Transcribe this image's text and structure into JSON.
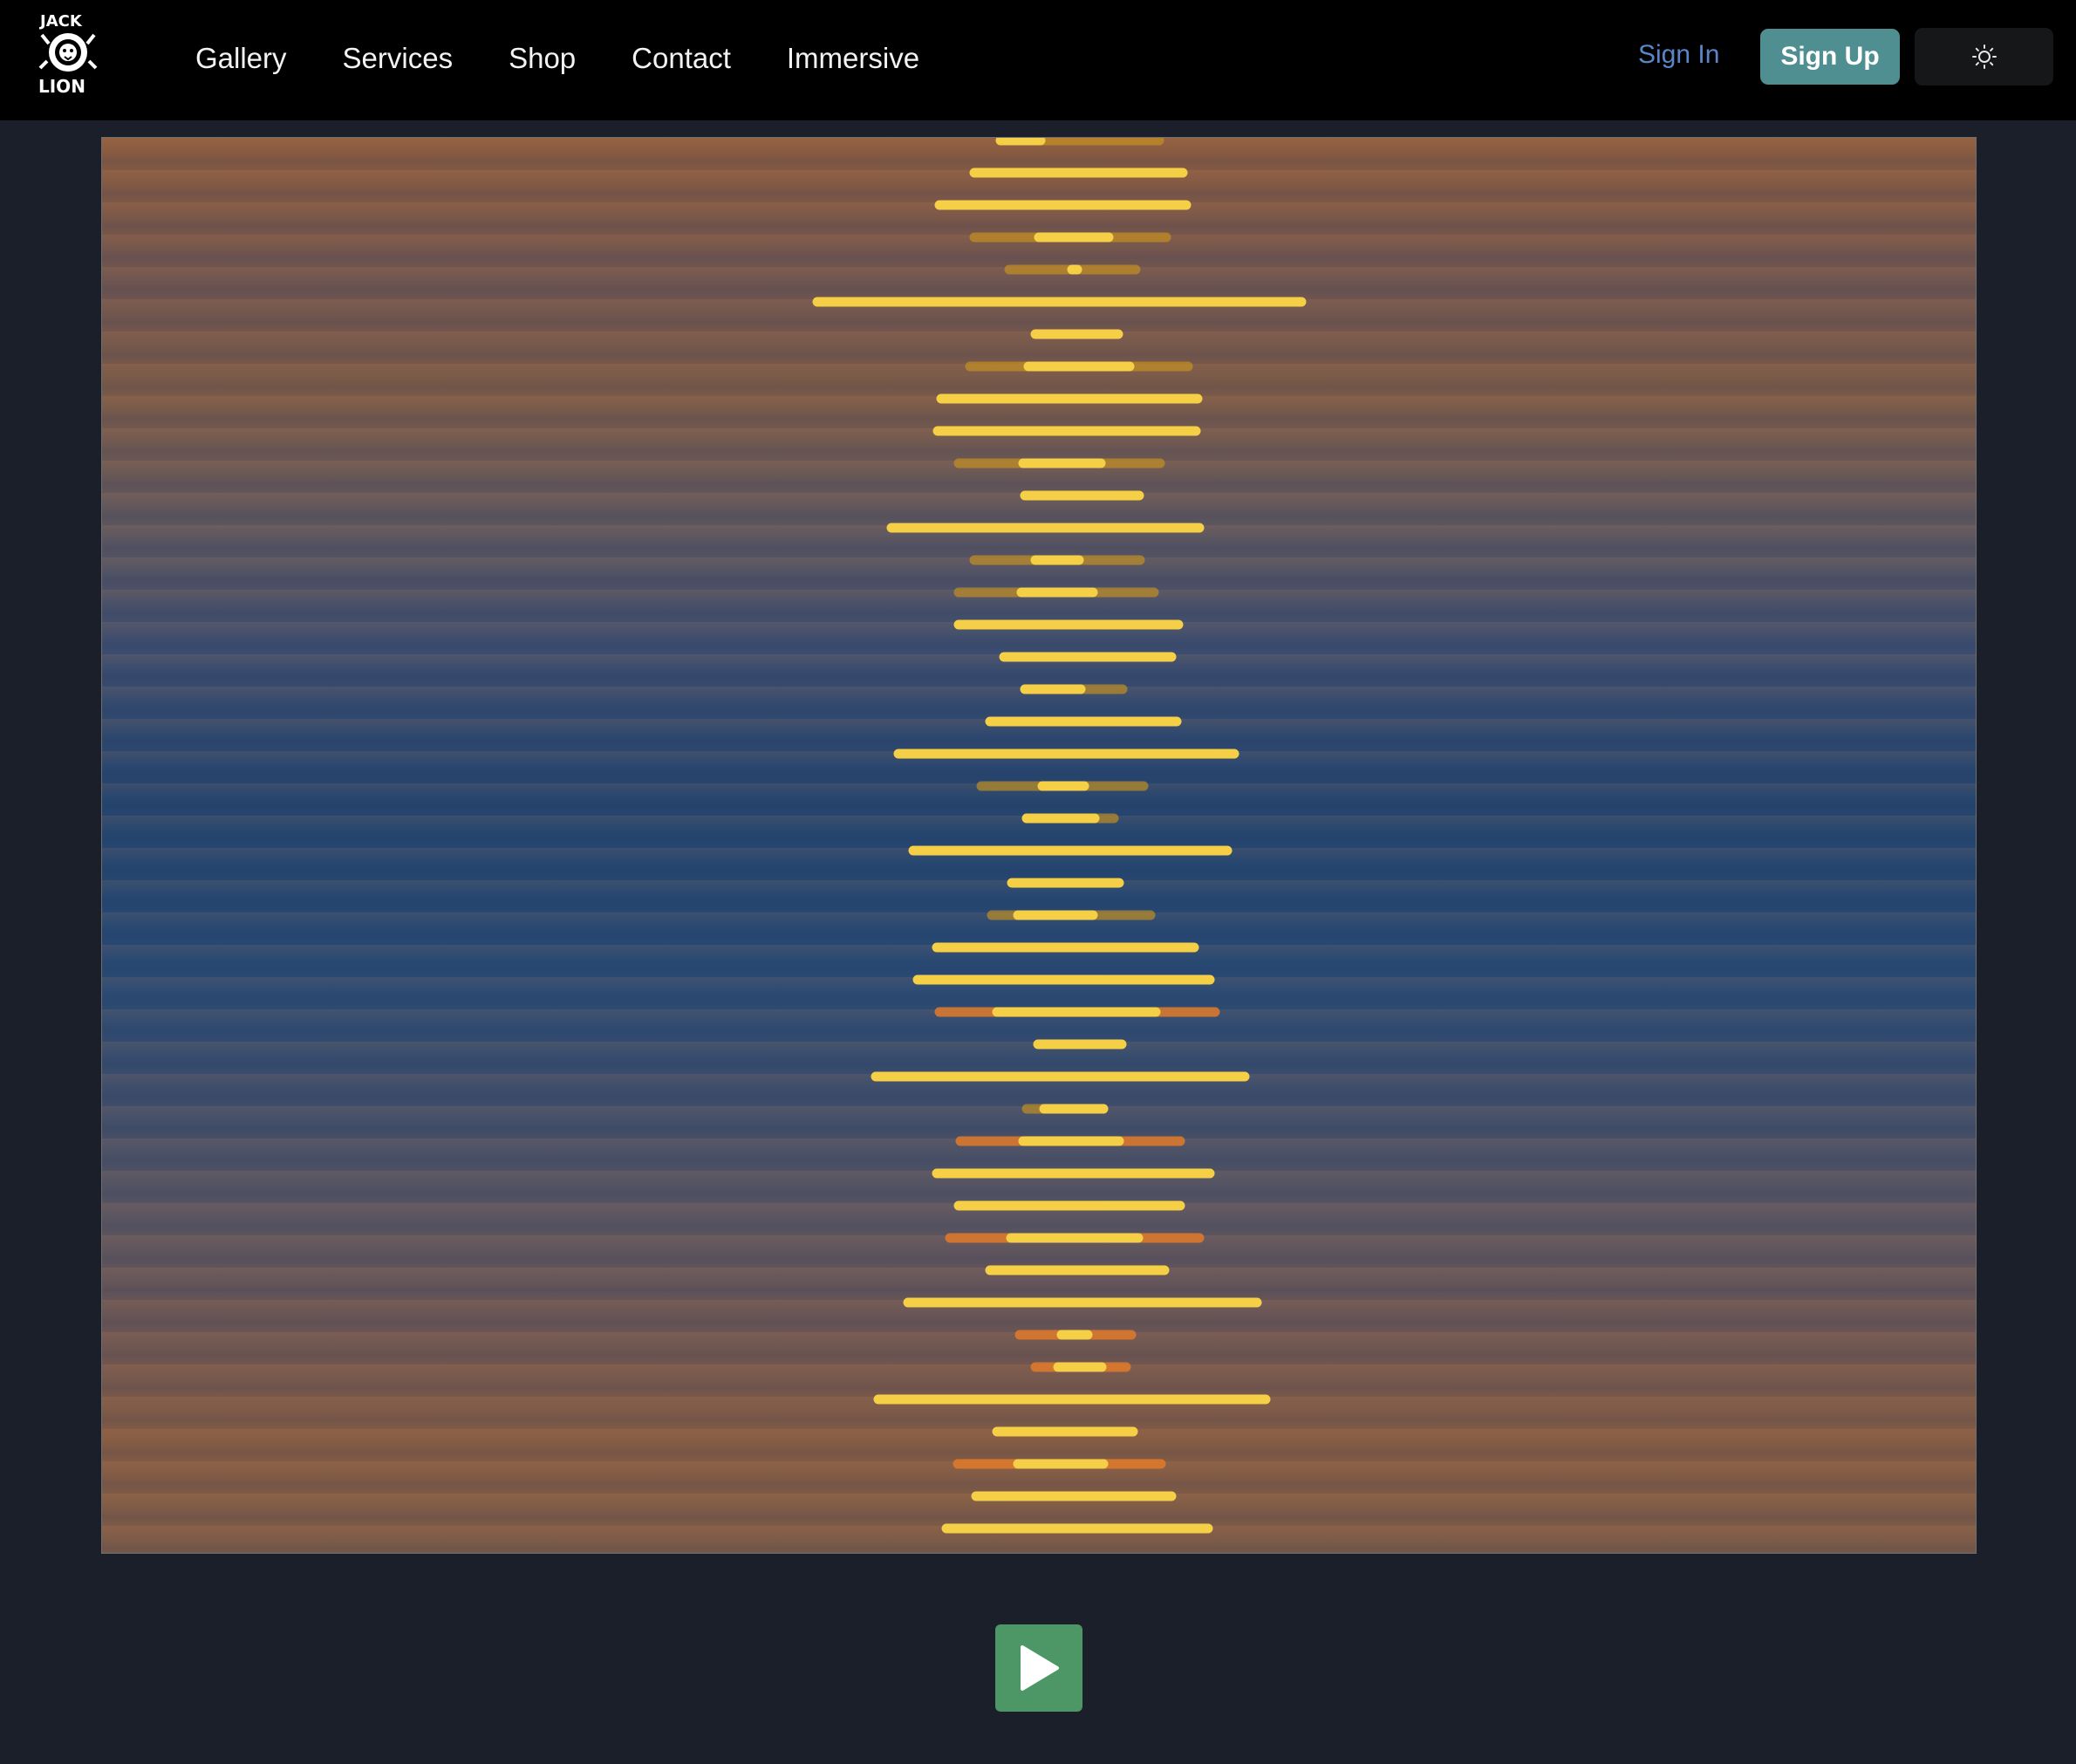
{
  "brand": {
    "name": "Jack Lion",
    "logo_icon": "lion-head-icon"
  },
  "nav": {
    "links": [
      {
        "label": "Gallery"
      },
      {
        "label": "Services"
      },
      {
        "label": "Shop"
      },
      {
        "label": "Contact"
      },
      {
        "label": "Immersive"
      }
    ],
    "sign_in": "Sign In",
    "sign_up": "Sign Up",
    "theme_icon": "sun-icon"
  },
  "colors": {
    "navbar": "#000000",
    "page_background": "#1b1f29",
    "sign_in_link": "#5a86c9",
    "sign_up_button": "#4f8f91",
    "play_button": "#4d9665",
    "bar_core": "#f5cf45",
    "bar_halo": "#c9941f",
    "bar_halo_orange": "#e07a2a"
  },
  "visualizer": {
    "bar_count": 44
  },
  "player": {
    "play_icon": "play-icon"
  }
}
